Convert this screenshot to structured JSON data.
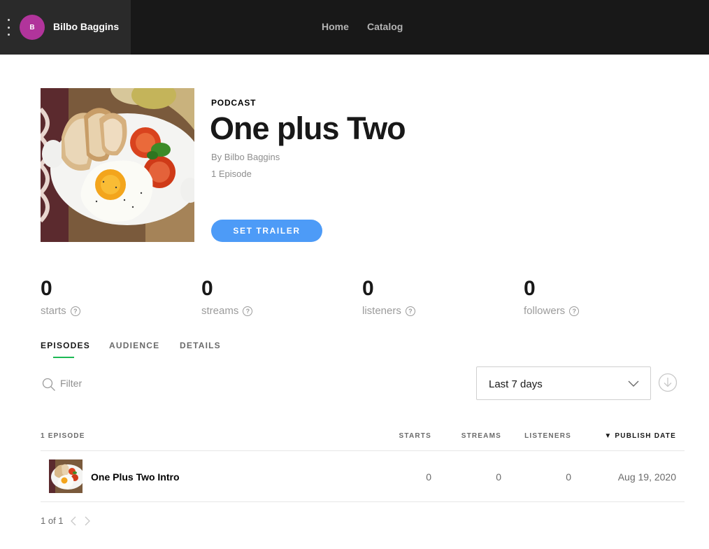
{
  "topbar": {
    "user": {
      "name": "Bilbo Baggins",
      "avatar_initial": "B",
      "avatar_color": "#b1349b"
    },
    "nav": {
      "home": "Home",
      "catalog": "Catalog"
    }
  },
  "podcast": {
    "kicker": "PODCAST",
    "title": "One plus Two",
    "byline": "By Bilbo Baggins",
    "episode_count": "1 Episode",
    "trailer_button": "SET TRAILER",
    "accent_color": "#4d9bf7"
  },
  "stats": [
    {
      "value": "0",
      "label": "starts"
    },
    {
      "value": "0",
      "label": "streams"
    },
    {
      "value": "0",
      "label": "listeners"
    },
    {
      "value": "0",
      "label": "followers"
    }
  ],
  "tabs": [
    {
      "label": "EPISODES",
      "active": true
    },
    {
      "label": "AUDIENCE",
      "active": false
    },
    {
      "label": "DETAILS",
      "active": false
    }
  ],
  "filter": {
    "placeholder": "Filter",
    "value": ""
  },
  "range": {
    "selected": "Last 7 days"
  },
  "table": {
    "headers": {
      "count": "1 EPISODE",
      "starts": "STARTS",
      "streams": "STREAMS",
      "listeners": "LISTENERS",
      "date": "▼ PUBLISH DATE"
    },
    "rows": [
      {
        "title": "One Plus Two Intro",
        "starts": "0",
        "streams": "0",
        "listeners": "0",
        "date": "Aug 19, 2020"
      }
    ]
  },
  "pagination": {
    "label": "1 of 1"
  },
  "icons": {
    "menu": "kebab-menu-icon",
    "help": "question-circle-icon",
    "search": "search-icon",
    "dropdown": "chevron-down-icon",
    "download": "download-circle-icon",
    "prev": "chevron-left-icon",
    "next": "chevron-right-icon"
  }
}
